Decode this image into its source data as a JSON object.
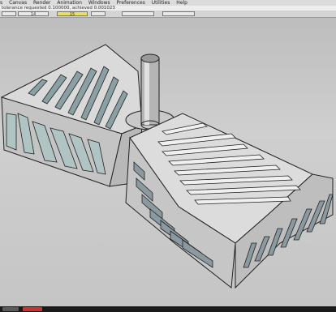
{
  "menu": {
    "items": [
      "s",
      "Canvas",
      "Render",
      "Animation",
      "Windows",
      "Preferences",
      "Utilities",
      "Help"
    ]
  },
  "status": {
    "message": "tolerance requested 0.100000, achieved 0.001023"
  },
  "toolbar": {
    "field_1": "14",
    "field_2": "15"
  },
  "colors": {
    "accent_field": "#e6e06a",
    "model_face": "#d8d8d8",
    "hole_fill": "#8aa0a4",
    "edge": "#222222",
    "taskbar_red": "#d23030"
  },
  "icons": {
    "model": "3d-model-view"
  }
}
